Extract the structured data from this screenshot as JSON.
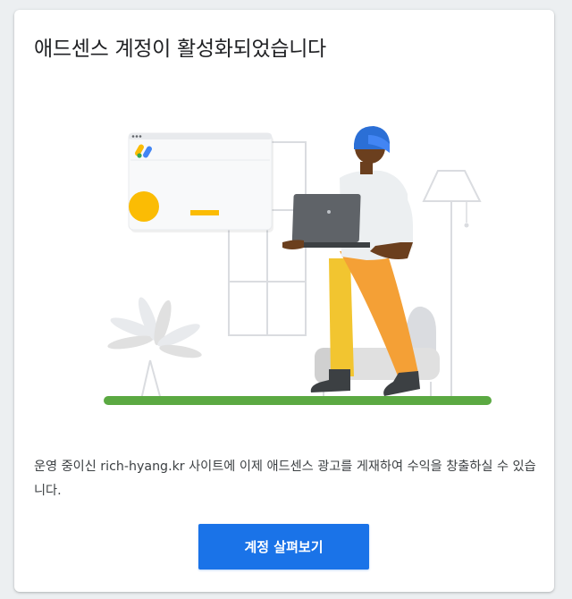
{
  "card": {
    "title": "애드센스 계정이 활성화되었습니다",
    "description_prefix": "운영 중이신 ",
    "site_name": "rich-hyang.kr",
    "description_suffix": " 사이트에 이제 애드센스 광고를 게재하여 수익을 창출하실 수 있습니다.",
    "button_label": "계정 살펴보기"
  },
  "illustration": {
    "icon": "adsense-logo-icon",
    "colors": {
      "blue": "#4285f4",
      "yellow": "#fbbc04",
      "green": "#34a853",
      "ground": "#5ba942",
      "pants": "#f4a036",
      "shirt": "#eceff1",
      "laptop": "#5f6368"
    }
  }
}
